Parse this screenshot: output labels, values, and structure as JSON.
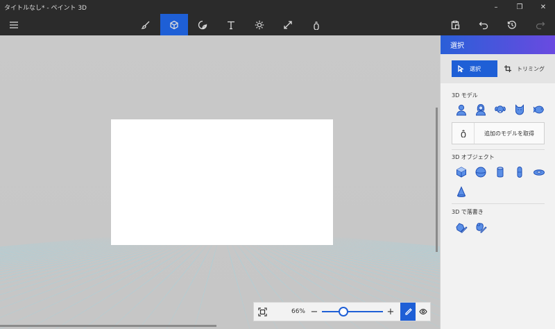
{
  "window": {
    "title": "タイトルなし* - ペイント 3D",
    "minimize": "–",
    "restore": "❐",
    "close": "✕"
  },
  "toolbar": {
    "menu_icon": "hamburger-icon",
    "tools": [
      {
        "icon": "brush-icon"
      },
      {
        "icon": "3d-cube-icon",
        "active": true
      },
      {
        "icon": "sticker-icon"
      },
      {
        "icon": "text-icon"
      },
      {
        "icon": "effects-sun-icon"
      },
      {
        "icon": "canvas-resize-icon"
      },
      {
        "icon": "3d-library-icon"
      }
    ],
    "right": [
      {
        "icon": "paste-icon"
      },
      {
        "icon": "undo-icon"
      },
      {
        "icon": "history-icon"
      },
      {
        "icon": "redo-icon",
        "disabled": true
      }
    ]
  },
  "zoom": {
    "percent": "66%",
    "minus": "−",
    "plus": "+",
    "level": 0.33
  },
  "panel": {
    "header": "選択",
    "select_label": "選択",
    "crop_label": "トリミング",
    "section_models": "3D モデル",
    "more_models_label": "追加のモデルを取得",
    "section_objects": "3D オブジェクト",
    "section_doodle": "3D で落書き"
  },
  "colors": {
    "accent": "#1e5fd6",
    "icon_fill": "#5b8fe6",
    "icon_stroke": "#1f4fb4",
    "titlebar": "#2b2b2b"
  }
}
